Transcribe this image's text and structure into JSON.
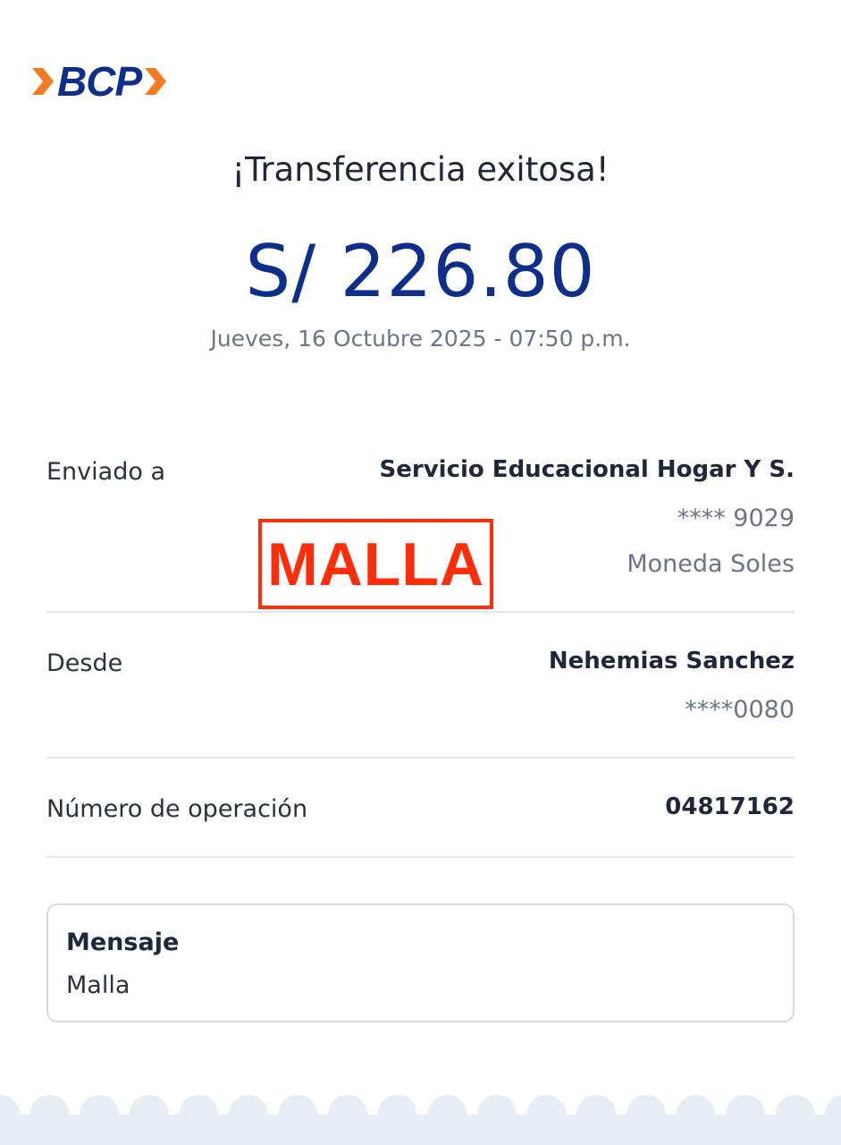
{
  "colors": {
    "brand_blue": "#0e2e8c",
    "brand_orange": "#f47b20",
    "stamp_red": "#ff2d0a",
    "footer_bg": "#e8edf3"
  },
  "logo": {
    "text": "BCP",
    "icons": [
      "chevron-right-icon",
      "chevron-right-icon"
    ]
  },
  "header": {
    "title": "¡Transferencia exitosa!",
    "amount": "S/ 226.80",
    "datetime": "Jueves, 16 Octubre 2025 - 07:50 p.m."
  },
  "details": {
    "sent_to": {
      "label": "Enviado a",
      "name": "Servicio Educacional Hogar Y S.",
      "account": "**** 9029",
      "currency": "Moneda Soles"
    },
    "from": {
      "label": "Desde",
      "name": "Nehemias Sanchez",
      "account": "****0080"
    },
    "operation": {
      "label": "Número de operación",
      "number": "04817162"
    }
  },
  "stamp": {
    "text": "MALLA"
  },
  "message": {
    "title": "Mensaje",
    "body": "Malla"
  }
}
